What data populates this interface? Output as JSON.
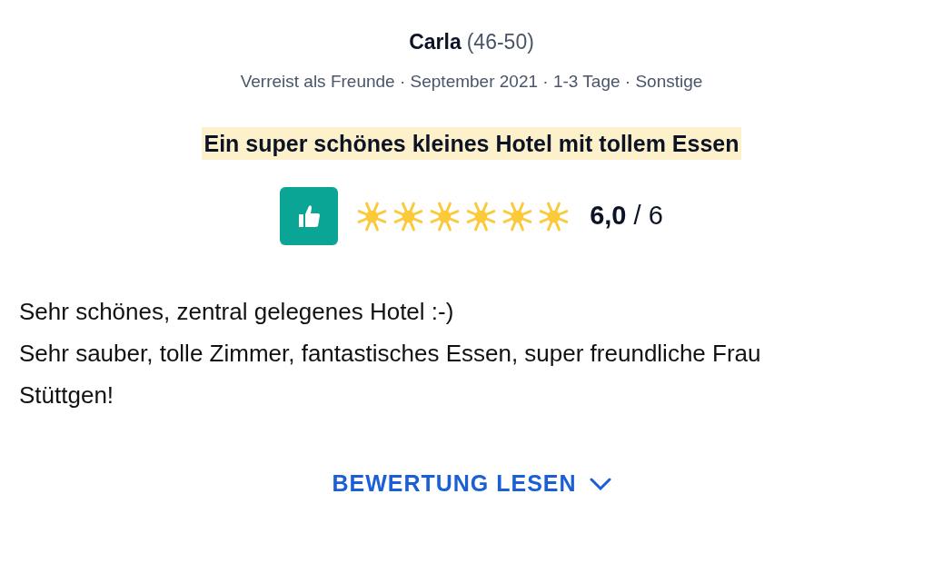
{
  "reviewer": {
    "name": "Carla",
    "age": "(46-50)"
  },
  "meta": "Verreist als Freunde · September 2021 · 1-3 Tage · Sonstige",
  "title": "Ein super schönes kleines Hotel mit tollem Essen",
  "rating": {
    "stars": 6,
    "score": "**6,0** / 6"
  },
  "body": [
    "Sehr schönes, zentral gelegenes Hotel :-)",
    "Sehr sauber, tolle Zimmer, fantastisches Essen, super freundliche Frau Stüttgen!"
  ],
  "link": "BEWERTUNG LESEN"
}
